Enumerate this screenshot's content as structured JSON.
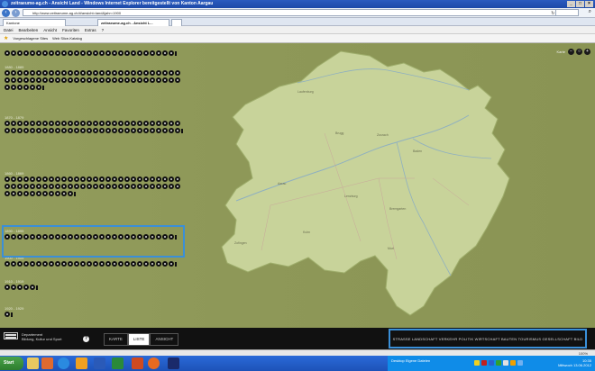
{
  "window": {
    "title": "zeitraeume-ag.ch - Ansicht Land - Windows Internet Explorer bereitgestellt von Kanton Aargau"
  },
  "browser": {
    "url": "http://www.zeitraeume-ag.ch/#/ansicht=land&jahr=1900",
    "search_placeholder": "",
    "tabs": [
      {
        "label": "Kantone"
      },
      {
        "label": "zeitraeume-ag.ch - Ansicht L..."
      }
    ],
    "menu": [
      "Datei",
      "Bearbeiten",
      "Ansicht",
      "Favoriten",
      "Extras",
      "?"
    ],
    "favorites": [
      {
        "label": "Vorgeschlagene Sites"
      },
      {
        "label": "Web Slice-Katalog"
      }
    ]
  },
  "map": {
    "zoom_label": "Karte",
    "towns": [
      "Brugg",
      "Laufenburg",
      "Zurzach",
      "Baden",
      "Aarau",
      "Lenzburg",
      "Bremgarten",
      "Zofingen",
      "Muri",
      "Kulm"
    ]
  },
  "decades": [
    {
      "label": "",
      "pins": 27
    },
    {
      "label": "1880 - 1889",
      "pins": 62
    },
    {
      "label": "1870 - 1879",
      "pins": 56
    },
    {
      "label": "1860 - 1869",
      "pins": 67
    },
    {
      "label": "1890 - 1899",
      "pins": 27,
      "highlighted": true
    },
    {
      "label": "1900 - 1909",
      "pins": 27
    },
    {
      "label": "1910 - 1919",
      "pins": 5
    },
    {
      "label": "1920 - 1929",
      "pins": 1
    }
  ],
  "footer": {
    "dept_line1": "Departement",
    "dept_line2": "Bildung, Kultur und Sport",
    "help": "?",
    "modes": [
      "KARTE",
      "LISTE",
      "ANSICHT"
    ],
    "active_mode": "LISTE",
    "categories": [
      "STRASSE",
      "LANDSCHAFT",
      "VERKEHR",
      "POLITIK",
      "WIRTSCHAFT",
      "BAUTEN",
      "TOURISMUS",
      "GESELLSCHAFT",
      "BILD"
    ]
  },
  "status": {
    "zoom": "100%"
  },
  "taskbar": {
    "start_label": "Start",
    "tray_text_1": "Desktop",
    "tray_text_2": "Eigene Dateien",
    "clock_time": "10:35",
    "clock_date": "Mittwoch 13.06.2012"
  }
}
